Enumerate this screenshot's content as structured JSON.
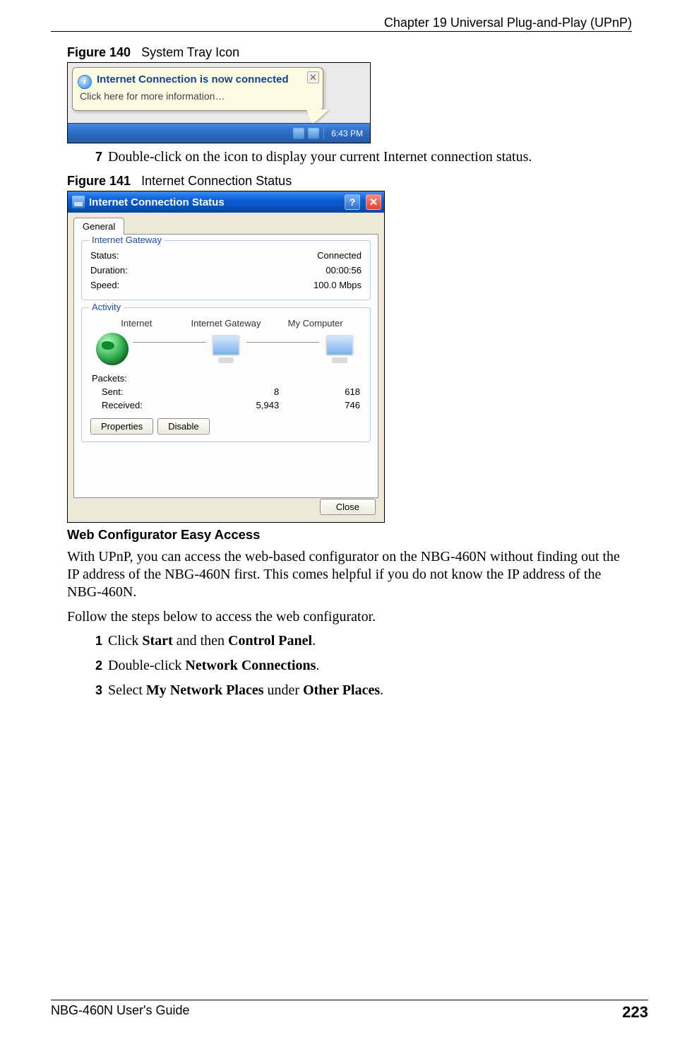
{
  "header": {
    "chapter": "Chapter 19 Universal Plug-and-Play (UPnP)"
  },
  "figure140": {
    "label": "Figure 140",
    "caption": "System Tray Icon",
    "balloon_title": "Internet Connection is now connected",
    "balloon_sub": "Click here for more information…",
    "taskbar_time": "6:43 PM"
  },
  "step7": {
    "num": "7",
    "text": "Double-click on the icon to display your current Internet connection status."
  },
  "figure141": {
    "label": "Figure 141",
    "caption": "Internet Connection Status",
    "window_title": "Internet Connection Status",
    "tab_general": "General",
    "group_gateway": {
      "legend": "Internet Gateway",
      "status_label": "Status:",
      "status_value": "Connected",
      "duration_label": "Duration:",
      "duration_value": "00:00:56",
      "speed_label": "Speed:",
      "speed_value": "100.0 Mbps"
    },
    "group_activity": {
      "legend": "Activity",
      "col_internet": "Internet",
      "col_gateway": "Internet Gateway",
      "col_computer": "My Computer",
      "packets_label": "Packets:",
      "sent_label": "Sent:",
      "sent_gw": "8",
      "sent_pc": "618",
      "recv_label": "Received:",
      "recv_gw": "5,943",
      "recv_pc": "746"
    },
    "btn_properties": "Properties",
    "btn_disable": "Disable",
    "btn_close": "Close"
  },
  "section": {
    "heading": "Web Configurator Easy Access",
    "para1": "With UPnP, you can access the web-based configurator on the NBG-460N without finding out the IP address of the NBG-460N first. This comes helpful if you do not know the IP address of the NBG-460N.",
    "para2": "Follow the steps below to access the web configurator."
  },
  "steps": {
    "s1_num": "1",
    "s1_pre": "Click ",
    "s1_b1": "Start",
    "s1_mid": " and then ",
    "s1_b2": "Control Panel",
    "s1_post": ".",
    "s2_num": "2",
    "s2_pre": "Double-click ",
    "s2_b1": "Network Connections",
    "s2_post": ".",
    "s3_num": "3",
    "s3_pre": "Select ",
    "s3_b1": "My Network Places",
    "s3_mid": " under ",
    "s3_b2": "Other Places",
    "s3_post": "."
  },
  "footer": {
    "guide": "NBG-460N User's Guide",
    "page": "223"
  }
}
